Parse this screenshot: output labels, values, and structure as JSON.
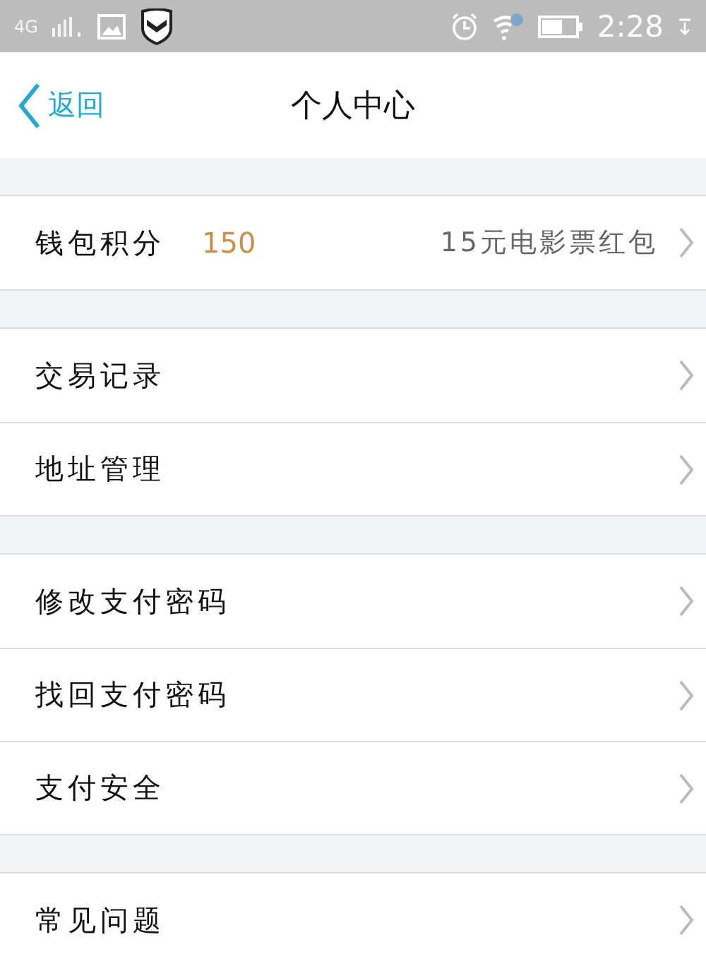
{
  "status_bar": {
    "network": "4G",
    "time": "2:28"
  },
  "header": {
    "back": "返回",
    "title": "个人中心"
  },
  "groups": [
    {
      "rows": [
        {
          "label": "钱包积分",
          "value": "150",
          "detail": "15元电影票红包"
        }
      ]
    },
    {
      "rows": [
        {
          "label": "交易记录"
        },
        {
          "label": "地址管理"
        }
      ]
    },
    {
      "rows": [
        {
          "label": "修改支付密码"
        },
        {
          "label": "找回支付密码"
        },
        {
          "label": "支付安全"
        }
      ]
    },
    {
      "rows": [
        {
          "label": "常见问题"
        }
      ]
    }
  ]
}
